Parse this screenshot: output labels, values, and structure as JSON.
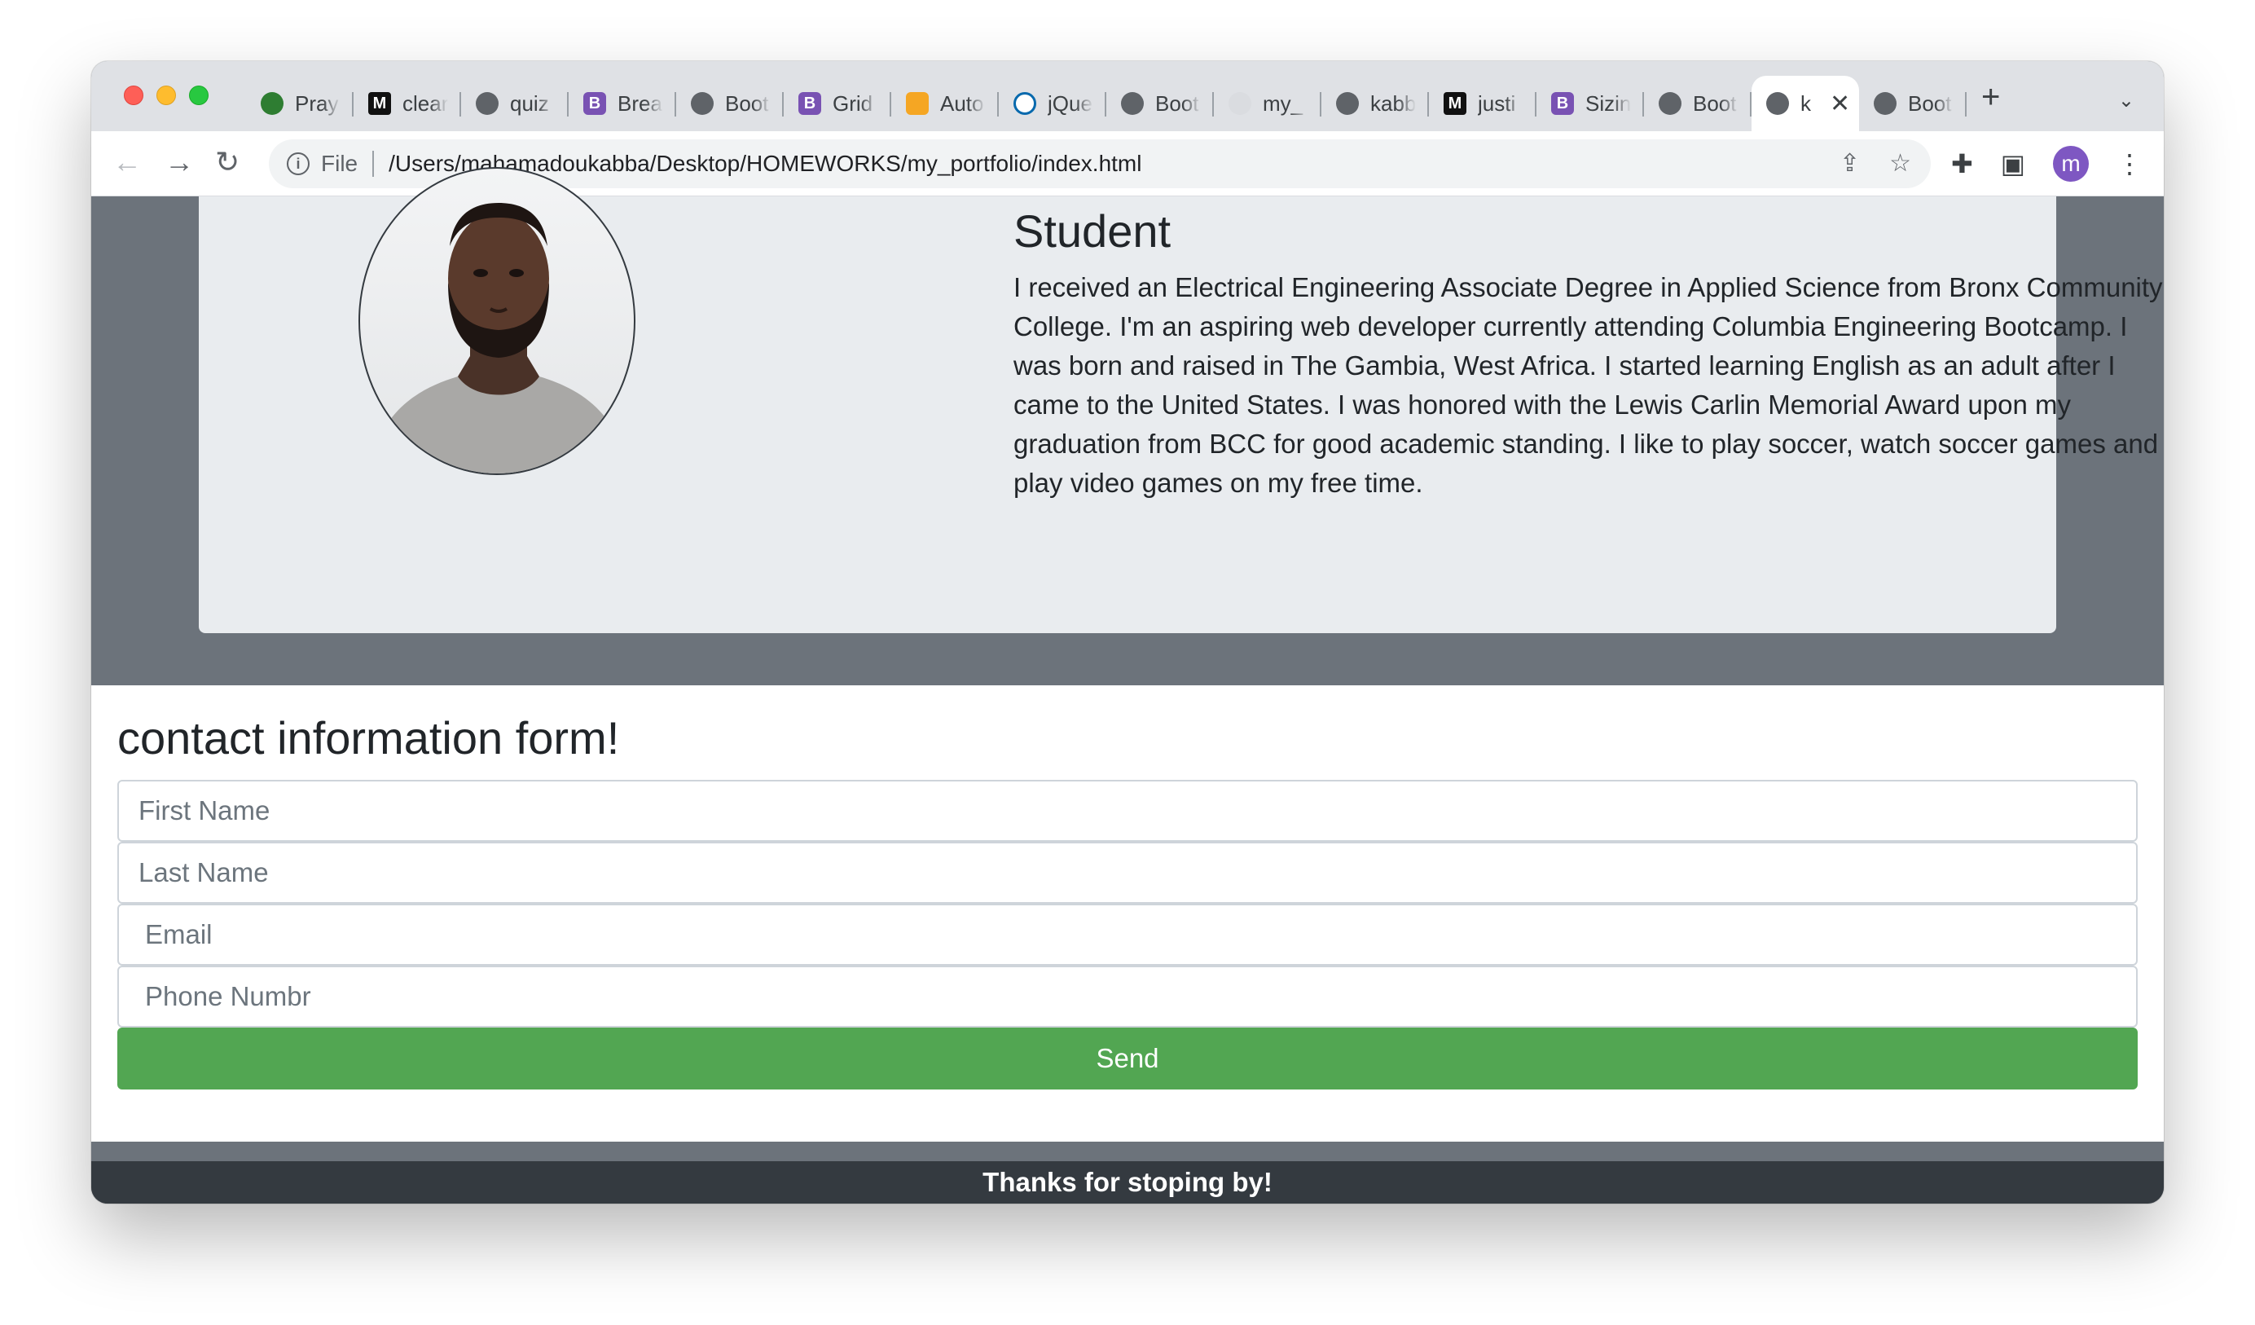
{
  "browser": {
    "tabs": [
      {
        "label": "Pray",
        "icon": "pray-app-icon",
        "color": "#2e7d32"
      },
      {
        "label": "clear",
        "icon": "m-logo-icon",
        "color": "#111111"
      },
      {
        "label": "quiz",
        "icon": "globe-icon",
        "color": "#5f6368"
      },
      {
        "label": "Brea",
        "icon": "bootstrap-icon",
        "color": "#7952b3"
      },
      {
        "label": "Boot",
        "icon": "globe-icon",
        "color": "#5f6368"
      },
      {
        "label": "Grid",
        "icon": "bootstrap-icon",
        "color": "#7952b3"
      },
      {
        "label": "Auto",
        "icon": "shield-icon",
        "color": "#f5a623"
      },
      {
        "label": "jQue",
        "icon": "jquery-icon",
        "color": "#0769ad"
      },
      {
        "label": "Boot",
        "icon": "globe-icon",
        "color": "#5f6368"
      },
      {
        "label": "my_",
        "icon": "github-icon",
        "color": "#dadce0"
      },
      {
        "label": "kabb",
        "icon": "globe-icon",
        "color": "#5f6368"
      },
      {
        "label": "justi",
        "icon": "m-logo-icon",
        "color": "#111111"
      },
      {
        "label": "Sizin",
        "icon": "bootstrap-icon",
        "color": "#7952b3"
      },
      {
        "label": "Boot",
        "icon": "globe-icon",
        "color": "#5f6368"
      },
      {
        "label": "k",
        "icon": "globe-icon",
        "color": "#5f6368",
        "active": true
      },
      {
        "label": "Boot",
        "icon": "globe-icon",
        "color": "#5f6368"
      }
    ],
    "glyphs": {
      "b": "B",
      "m": "M",
      "new_tab": "+",
      "close": "✕",
      "chevron": "⌄",
      "back": "←",
      "forward": "→",
      "reload": "↻",
      "info": "i",
      "share": "⇪",
      "star": "☆",
      "extensions": "✚",
      "sidepanel": "▣",
      "menu": "⋮"
    },
    "scheme_label": "File",
    "url": "/Users/mahamadoukabba/Desktop/HOMEWORKS/my_portfolio/index.html",
    "avatar_letter": "m"
  },
  "about": {
    "title": "Student",
    "text": "I received an Electrical Engineering Associate Degree in Applied Science from Bronx Community College. I'm an aspiring web developer currently attending Columbia Engineering Bootcamp. I was born and raised in The Gambia, West Africa. I started learning English as an adult after I came to the United States. I was honored with the Lewis Carlin Memorial Award upon my graduation from BCC for good academic standing. I like to play soccer, watch soccer games and play video games on my free time."
  },
  "contact": {
    "title": "contact information form!",
    "first_name_placeholder": "First Name",
    "last_name_placeholder": "Last Name",
    "email_placeholder": "Email",
    "phone_placeholder": "Phone Numbr",
    "send_label": "Send"
  },
  "footer": {
    "text": "Thanks for stoping by!"
  },
  "colors": {
    "page_bg": "#6c737b",
    "card_bg": "#e9ecef",
    "send_button": "#52a652",
    "footer_bg": "#343a40"
  }
}
